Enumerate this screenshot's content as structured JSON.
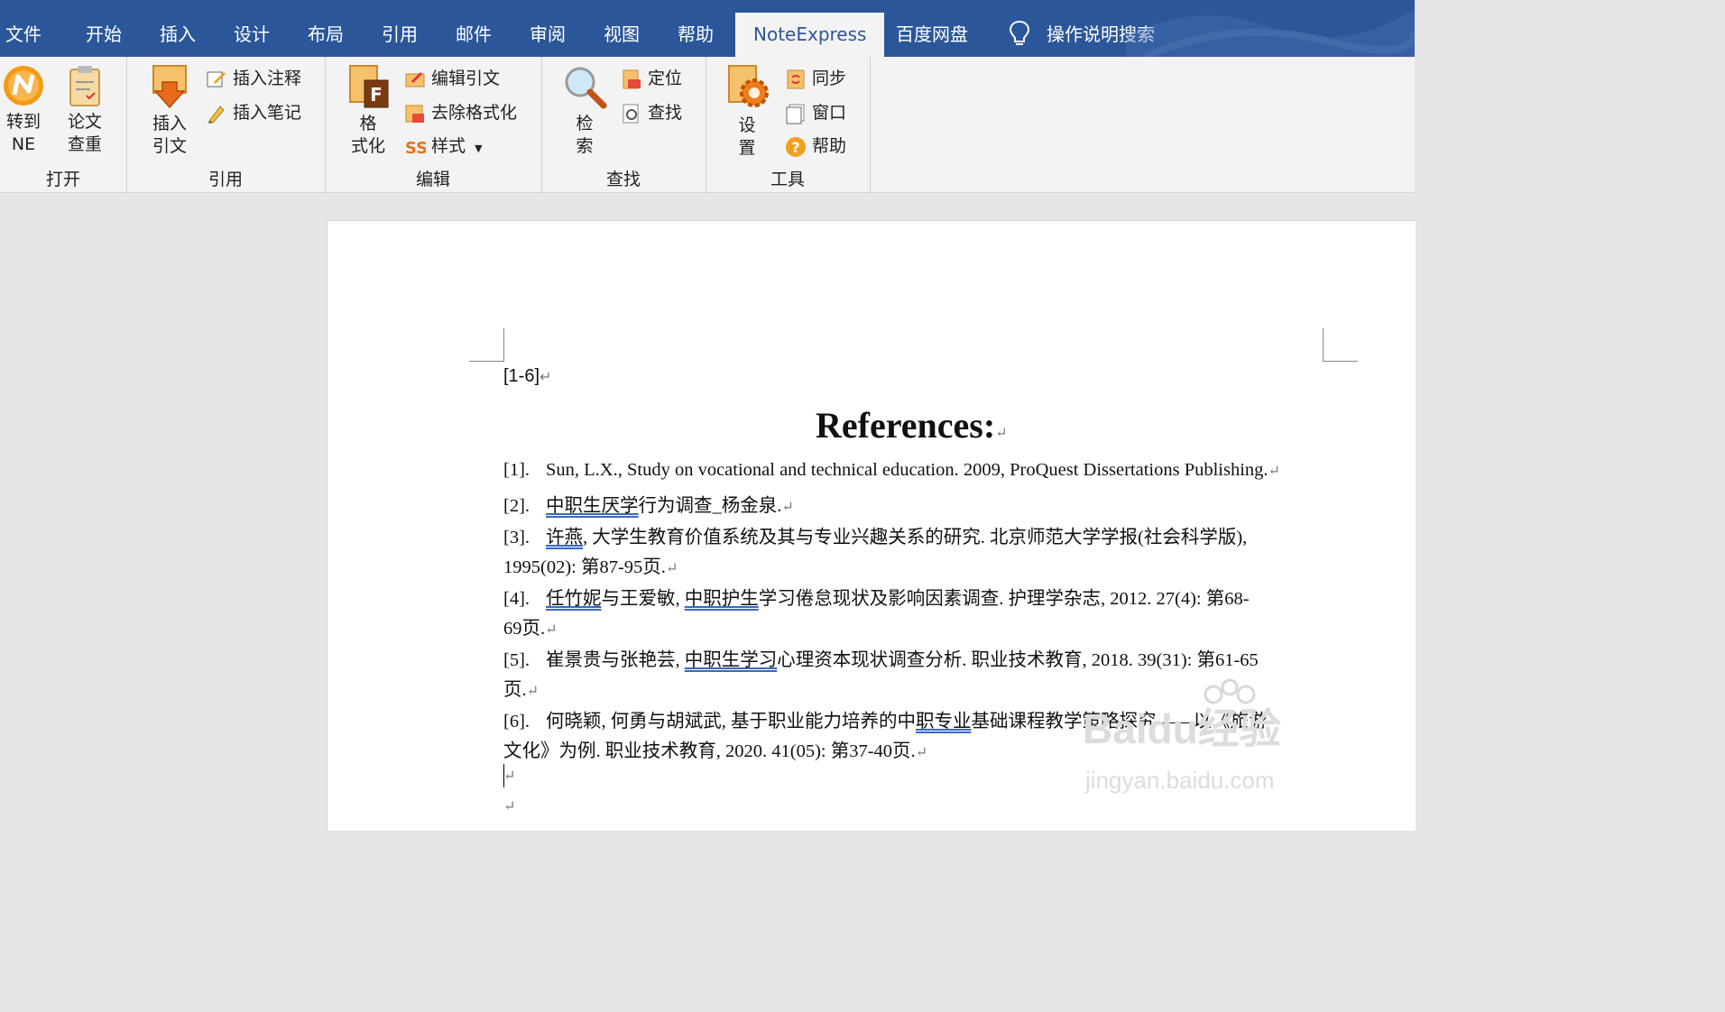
{
  "tabs": [
    {
      "label": "文件"
    },
    {
      "label": "开始"
    },
    {
      "label": "插入"
    },
    {
      "label": "设计"
    },
    {
      "label": "布局"
    },
    {
      "label": "引用"
    },
    {
      "label": "邮件"
    },
    {
      "label": "审阅"
    },
    {
      "label": "视图"
    },
    {
      "label": "帮助"
    },
    {
      "label": "NoteExpress"
    },
    {
      "label": "百度网盘"
    }
  ],
  "search_label": "操作说明搜索",
  "ribbon": {
    "open": {
      "label": "打开",
      "goto_ne_line1": "转到",
      "goto_ne_line2": "NE",
      "paper_check_line1": "论文",
      "paper_check_line2": "查重"
    },
    "cite": {
      "label": "引用",
      "insert_cite_line1": "插入",
      "insert_cite_line2": "引文",
      "insert_note": "插入注释",
      "insert_memo": "插入笔记"
    },
    "edit": {
      "label": "编辑",
      "format_line1": "格",
      "format_line2": "式化",
      "edit_cite": "编辑引文",
      "remove_format": "去除格式化",
      "style": "样式"
    },
    "find": {
      "label": "查找",
      "search_line1": "检",
      "search_line2": "索",
      "locate": "定位",
      "find": "查找"
    },
    "tools": {
      "label": "工具",
      "settings_line1": "设",
      "settings_line2": "置",
      "sync": "同步",
      "window": "窗口",
      "help": "帮助"
    }
  },
  "document": {
    "cite_marker": "[1-6]",
    "heading": "References:",
    "refs": [
      {
        "num": "[1].",
        "text": "Sun, L.X., Study on vocational and technical education. 2009, ProQuest Dissertations Publishing."
      },
      {
        "num": "[2].",
        "ul": "中职生厌学",
        "rest": "行为调查_杨金泉."
      },
      {
        "num": "[3].",
        "ul": "许燕",
        "rest": ", 大学生教育价值系统及其与专业兴趣关系的研究. 北京师范大学学报(社会科学版),",
        "cont": "1995(02): 第87-95页."
      },
      {
        "num": "[4].",
        "ul": "任竹妮",
        "mid": "与王爱敏, ",
        "ul2": "中职护生",
        "rest": "学习倦怠现状及影响因素调查. 护理学杂志, 2012. 27(4): 第68-",
        "cont": "69页."
      },
      {
        "num": "[5].",
        "pre": "崔景贵与张艳芸, ",
        "ul": "中职生学习",
        "rest": "心理资本现状调查分析. 职业技术教育, 2018. 39(31): 第61-65",
        "cont": "页."
      },
      {
        "num": "[6].",
        "pre": "何晓颖, 何勇与胡斌武, 基于职业能力培养的中",
        "ul": "职专业",
        "rest": "基础课程教学策略探究——以《旅游",
        "cont": "文化》为例. 职业技术教育, 2020. 41(05): 第37-40页."
      }
    ],
    "para_mark": "↵"
  },
  "watermark": {
    "brand": "Baidu经验",
    "url": "jingyan.baidu.com"
  },
  "colors": {
    "titlebar": "#2b579a",
    "ribbon": "#f3f3f3",
    "underline": "#3b66c4"
  }
}
